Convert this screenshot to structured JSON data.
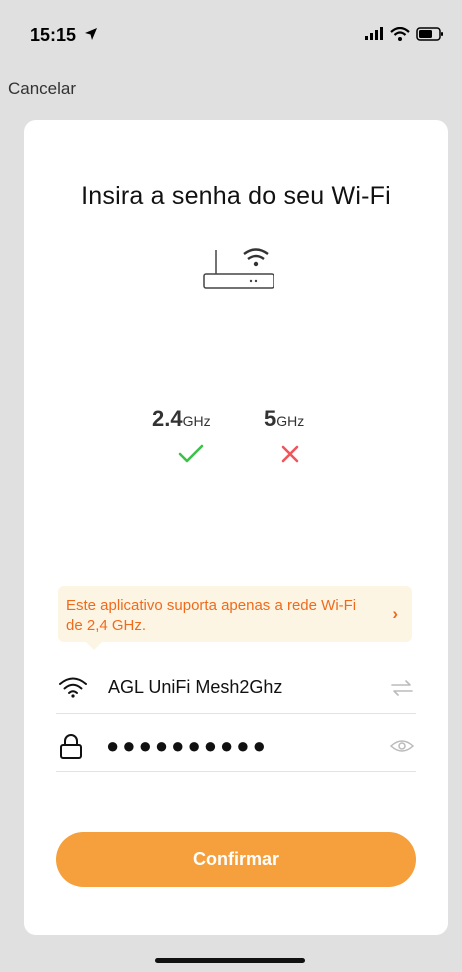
{
  "status_bar": {
    "time": "15:15"
  },
  "nav": {
    "cancel_label": "Cancelar"
  },
  "card": {
    "title": "Insira a senha do seu Wi-Fi",
    "bands": [
      {
        "value": "2.4",
        "unit": "GHz",
        "supported": true
      },
      {
        "value": "5",
        "unit": "GHz",
        "supported": false
      }
    ],
    "notice": {
      "text": "Este aplicativo suporta apenas a rede Wi-Fi de 2,4 GHz."
    },
    "ssid_field": {
      "value": "AGL UniFi Mesh2Ghz"
    },
    "password_field": {
      "value": "●●●●●●●●●●"
    },
    "confirm_label": "Confirmar"
  },
  "colors": {
    "accent": "#f5a03c",
    "notice_text": "#f06a1c",
    "ok_green": "#3cc24a",
    "no_red": "#f0565a"
  }
}
